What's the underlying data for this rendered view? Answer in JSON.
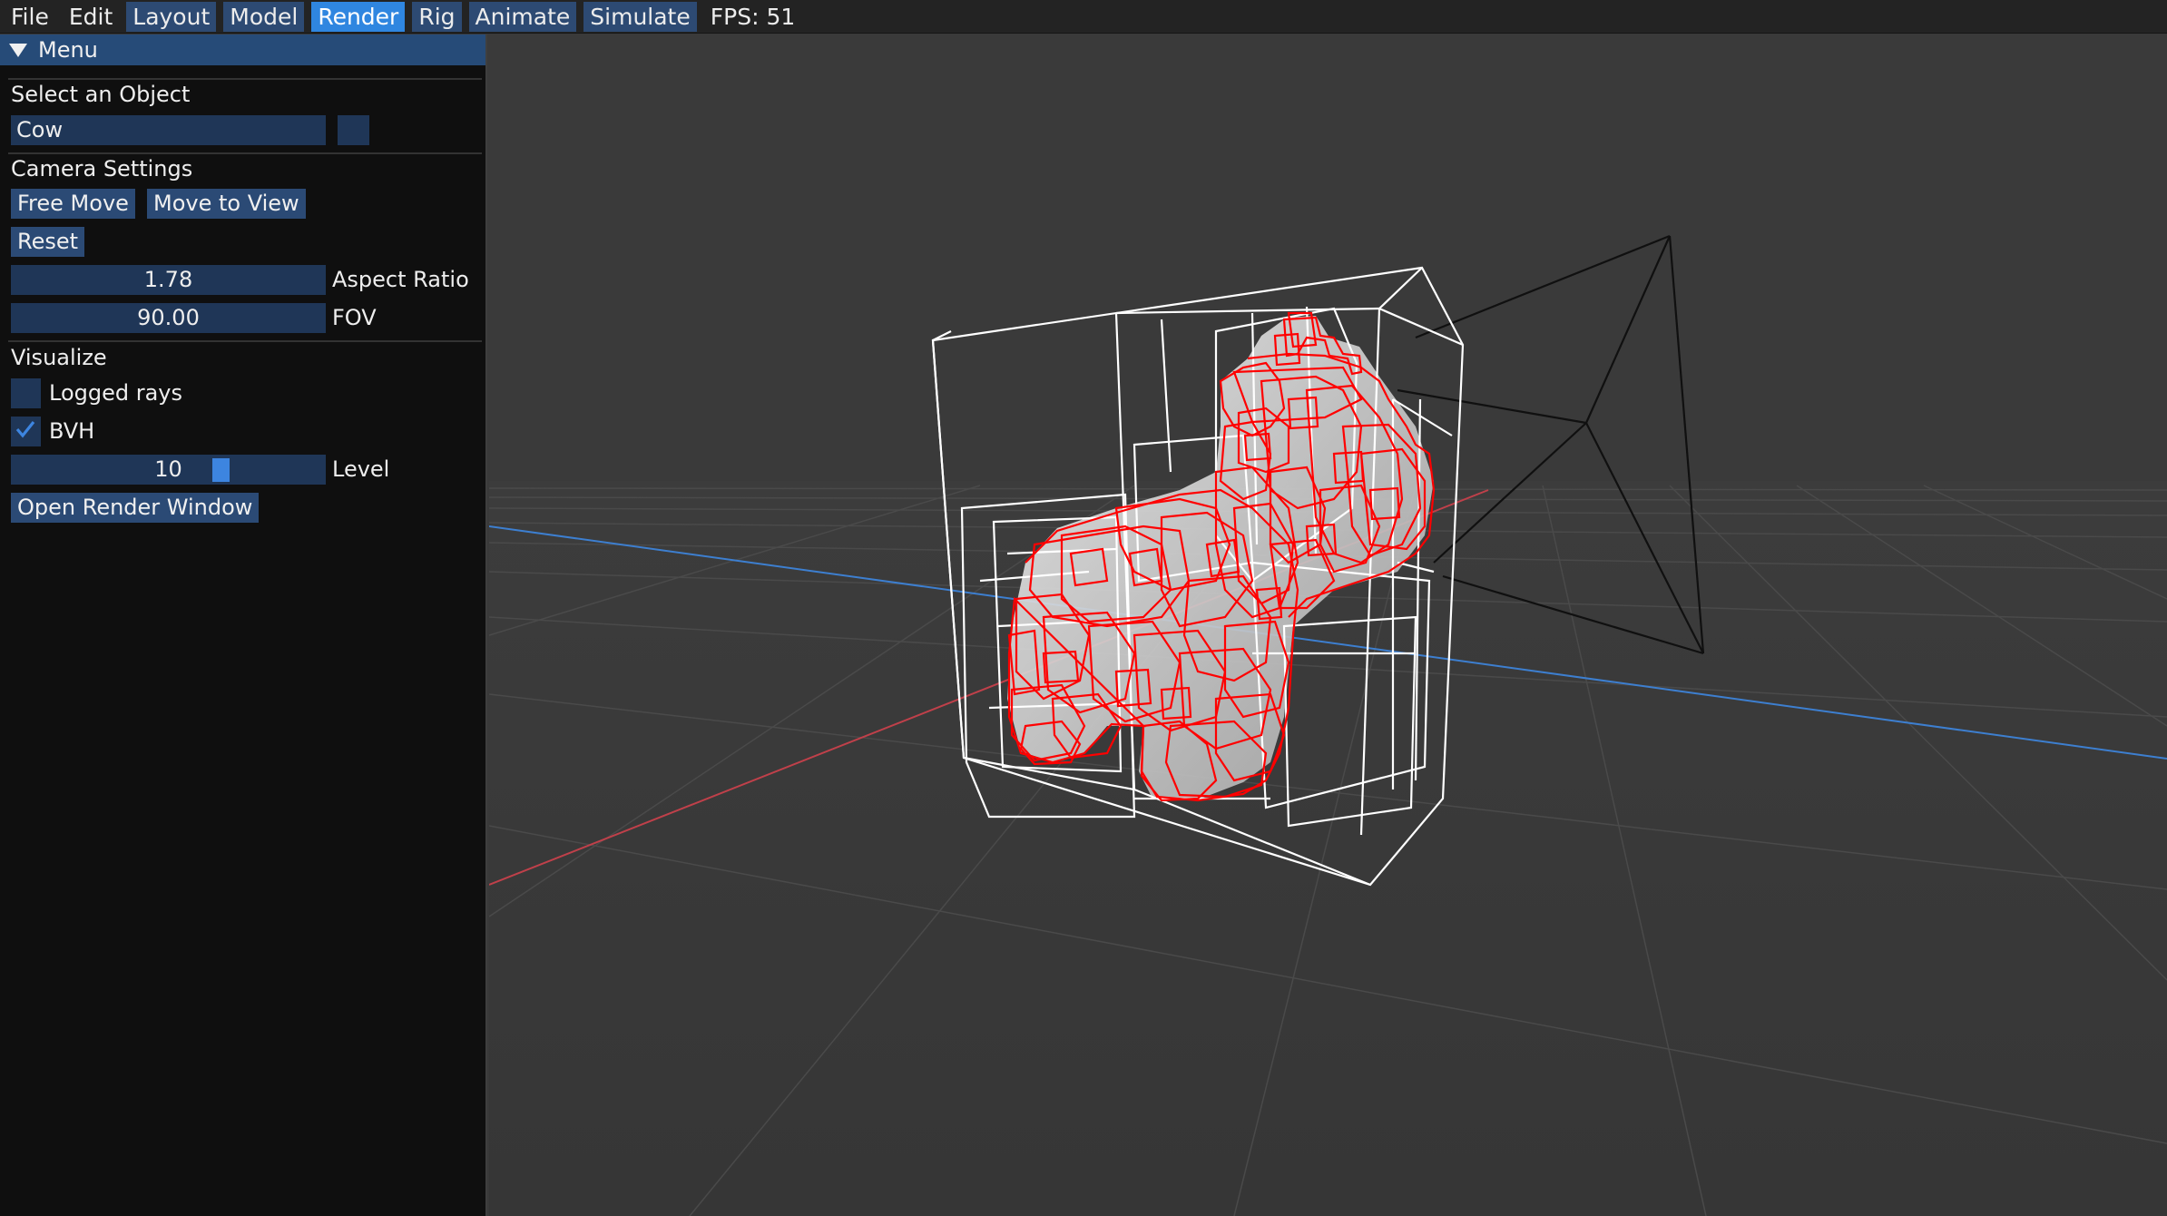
{
  "menubar": {
    "items": [
      {
        "label": "File",
        "style": "plain"
      },
      {
        "label": "Edit",
        "style": "plain"
      },
      {
        "label": "Layout",
        "style": "boxed"
      },
      {
        "label": "Model",
        "style": "boxed"
      },
      {
        "label": "Render",
        "style": "active"
      },
      {
        "label": "Rig",
        "style": "boxed"
      },
      {
        "label": "Animate",
        "style": "boxed"
      },
      {
        "label": "Simulate",
        "style": "boxed"
      }
    ],
    "fps": "FPS: 51"
  },
  "panel": {
    "title": "Menu",
    "select_object": {
      "label": "Select an Object",
      "value": "Cow"
    },
    "camera": {
      "heading": "Camera Settings",
      "free_move": "Free Move",
      "move_to_view": "Move to View",
      "reset": "Reset",
      "aspect_value": "1.78",
      "aspect_label": "Aspect Ratio",
      "fov_value": "90.00",
      "fov_label": "FOV"
    },
    "visualize": {
      "heading": "Visualize",
      "logged_rays_label": "Logged rays",
      "logged_rays_checked": false,
      "bvh_label": "BVH",
      "bvh_checked": true,
      "level_value": "10",
      "level_label": "Level",
      "level_fraction": 0.68,
      "open_render_window": "Open Render Window"
    }
  },
  "colors": {
    "active_menu": "#2f86e0",
    "button": "#2b4a75",
    "field": "#1f3657",
    "bvh_leaf": "#ff0000",
    "bvh_box": "#ffffff",
    "axis_x": "#c0404a",
    "axis_z": "#3d7fd0"
  }
}
